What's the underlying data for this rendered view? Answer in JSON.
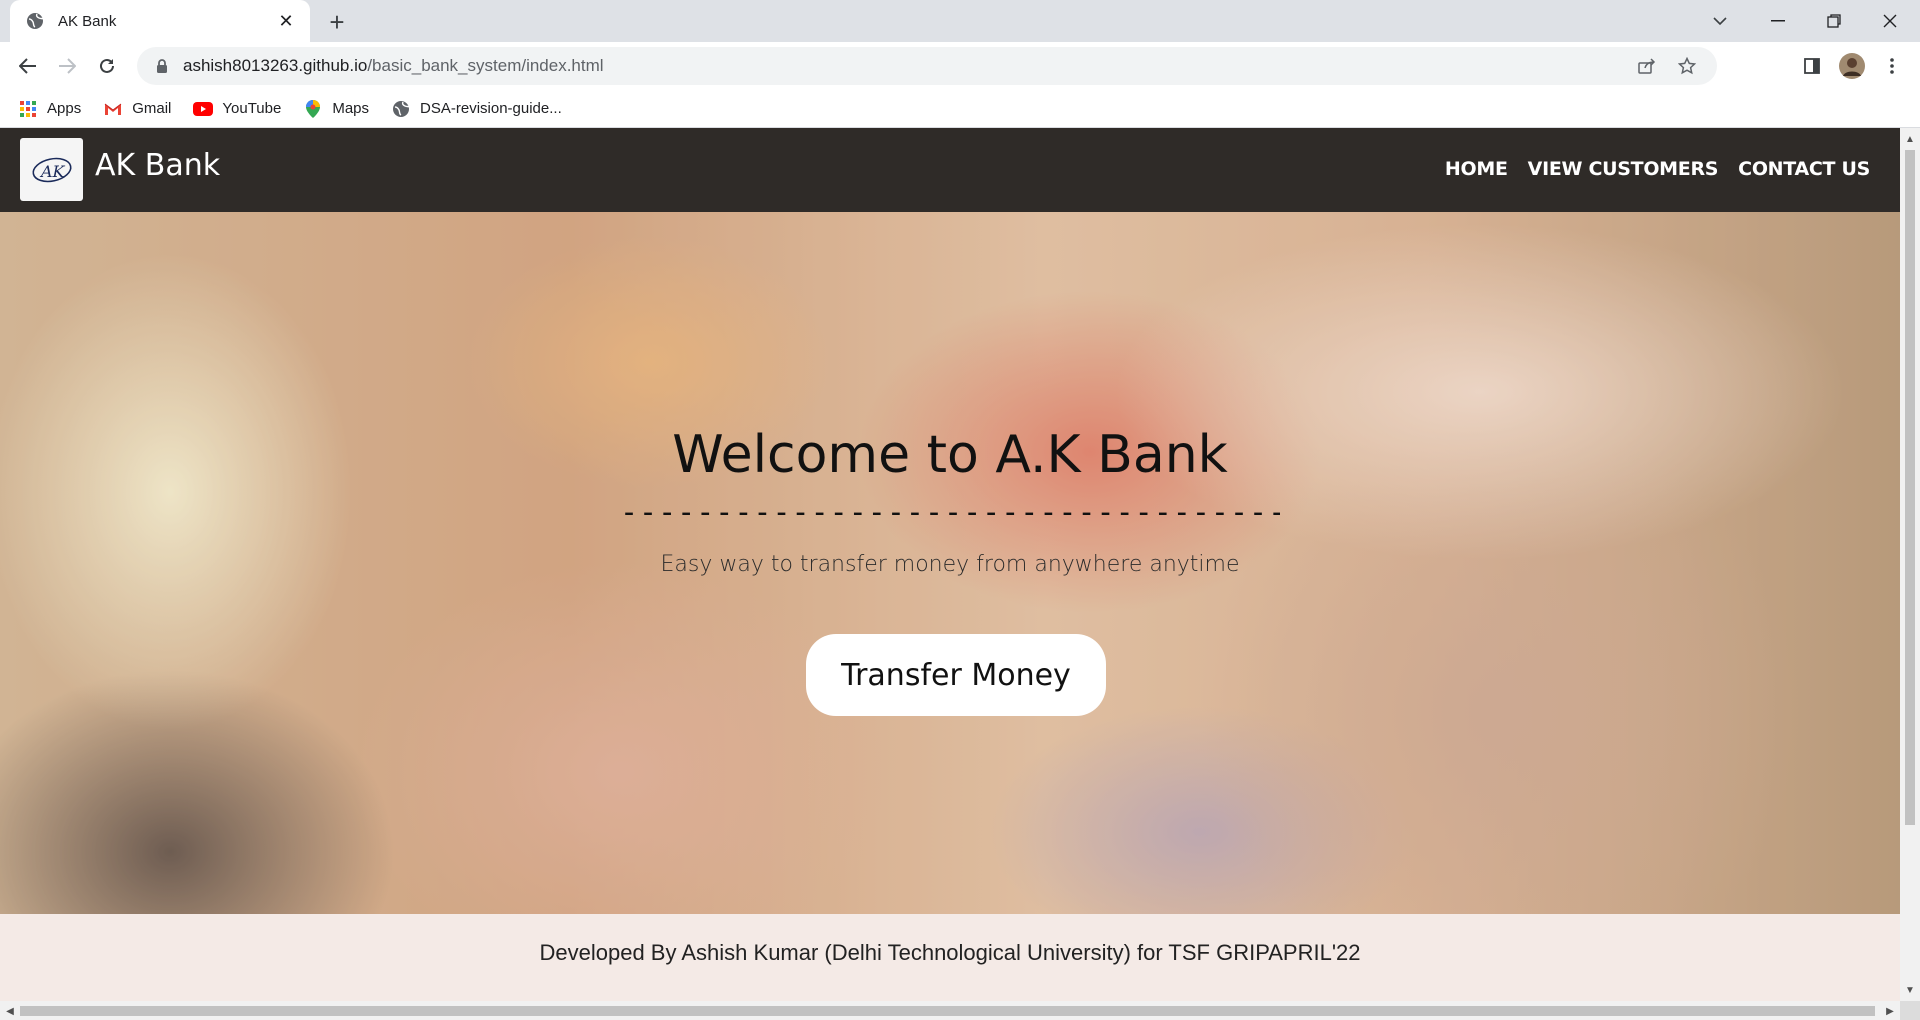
{
  "browser": {
    "tab_title": "AK Bank",
    "url_host": "ashish8013263.github.io",
    "url_path": "/basic_bank_system/index.html",
    "bookmarks": [
      {
        "label": "Apps",
        "icon": "apps-grid-icon"
      },
      {
        "label": "Gmail",
        "icon": "gmail-icon"
      },
      {
        "label": "YouTube",
        "icon": "youtube-icon"
      },
      {
        "label": "Maps",
        "icon": "maps-pin-icon"
      },
      {
        "label": "DSA-revision-guide...",
        "icon": "globe-icon"
      }
    ]
  },
  "navbar": {
    "logo_text": "AK",
    "brand": "AK Bank",
    "links": [
      "HOME",
      "VIEW CUSTOMERS",
      "CONTACT US"
    ]
  },
  "hero": {
    "title": "Welcome to A.K Bank",
    "divider": "------------------------------------------",
    "subtitle": "Easy way to transfer money from anywhere anytime",
    "button_label": "Transfer Money"
  },
  "footer": {
    "text": "Developed By Ashish Kumar (Delhi Technological University) for TSF GRIPAPRIL'22"
  },
  "colors": {
    "navbar_bg": "#2f2b28",
    "footer_bg": "#f4eae6",
    "tabstrip_bg": "#dee1e6"
  }
}
